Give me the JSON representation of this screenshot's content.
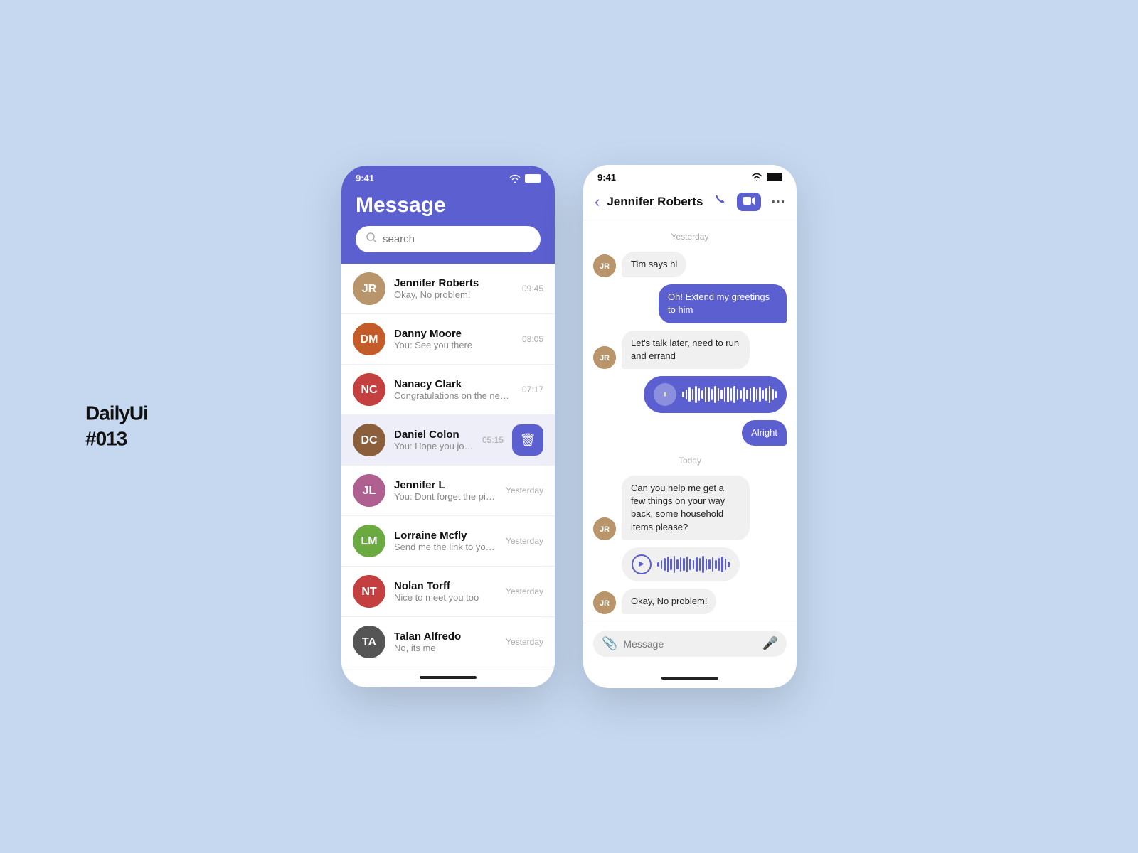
{
  "brand": {
    "line1": "DailyUi",
    "line2": "#013"
  },
  "left_phone": {
    "status_bar": {
      "time": "9:41"
    },
    "header": {
      "title": "Message",
      "search_placeholder": "search"
    },
    "contacts": [
      {
        "id": "jennifer-roberts",
        "name": "Jennifer Roberts",
        "preview": "Okay, No problem!",
        "time": "09:45",
        "avatar_initials": "JR",
        "avatar_class": "av-jennifer"
      },
      {
        "id": "danny-moore",
        "name": "Danny Moore",
        "preview": "You: See you there",
        "time": "08:05",
        "avatar_initials": "DM",
        "avatar_class": "av-danny"
      },
      {
        "id": "nanacy-clark",
        "name": "Nanacy Clark",
        "preview": "Congratulations on the new project",
        "time": "07:17",
        "avatar_initials": "NC",
        "avatar_class": "av-nanacy"
      },
      {
        "id": "daniel-colon",
        "name": "Daniel Colon",
        "preview": "You: Hope you join us",
        "time": "05:15",
        "avatar_initials": "DC",
        "avatar_class": "av-daniel",
        "swiped": true
      },
      {
        "id": "jennifer-l",
        "name": "Jennifer L",
        "preview": "You: Dont forget the pizza",
        "time": "Yesterday",
        "avatar_initials": "JL",
        "avatar_class": "av-jenniferl"
      },
      {
        "id": "lorraine-mcfly",
        "name": "Lorraine Mcfly",
        "preview": "Send me the link to your project via e...",
        "time": "Yesterday",
        "avatar_initials": "LM",
        "avatar_class": "av-lorraine"
      },
      {
        "id": "nolan-torff",
        "name": "Nolan Torff",
        "preview": "Nice to meet you too",
        "time": "Yesterday",
        "avatar_initials": "NT",
        "avatar_class": "av-nolan"
      },
      {
        "id": "talan-alfredo",
        "name": "Talan Alfredo",
        "preview": "No, its me",
        "time": "Yesterday",
        "avatar_initials": "TA",
        "avatar_class": "av-talan"
      }
    ]
  },
  "right_phone": {
    "status_bar": {
      "time": "9:41"
    },
    "chat_name": "Jennifer Roberts",
    "messages": {
      "yesterday_label": "Yesterday",
      "today_label": "Today",
      "yesterday_messages": [
        {
          "type": "received",
          "text": "Tim says hi"
        },
        {
          "type": "sent",
          "text": "Oh! Extend my greetings to him"
        },
        {
          "type": "received",
          "text": "Let's talk later, need to run and errand"
        },
        {
          "type": "sent_voice",
          "label": "voice message"
        },
        {
          "type": "sent_text",
          "text": "Alright"
        }
      ],
      "today_messages": [
        {
          "type": "received",
          "text": "Can you help me get a few things on your way back, some household items please?"
        },
        {
          "type": "received_voice",
          "label": "voice message"
        },
        {
          "type": "received_text",
          "text": "Okay, No problem!"
        }
      ]
    },
    "input": {
      "placeholder": "Message"
    }
  },
  "ui": {
    "back_label": "‹",
    "delete_label": "🗑",
    "attach_label": "📎",
    "call_label": "📞",
    "video_label": "📹",
    "more_label": "⋯",
    "mic_label": "🎤",
    "accent_color": "#5b5fcf"
  }
}
